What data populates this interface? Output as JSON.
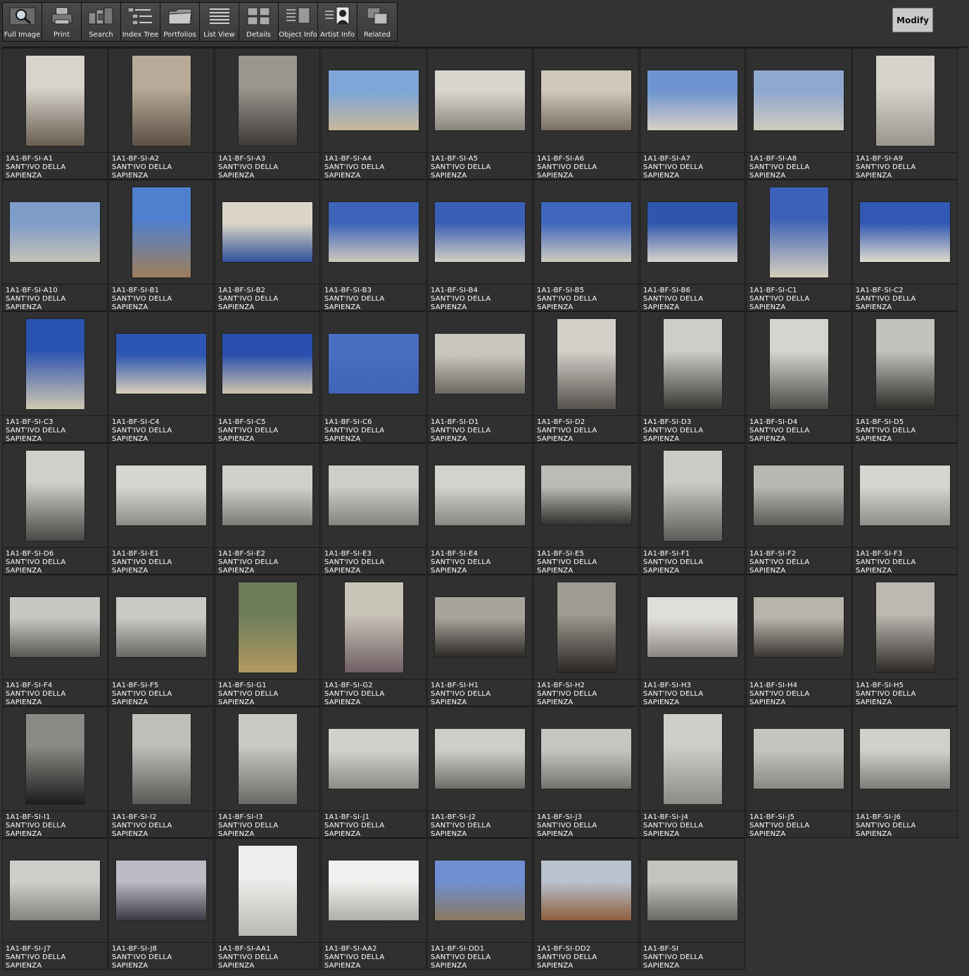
{
  "toolbar": {
    "buttons": [
      {
        "label": "Full Image",
        "icon": "magnifier-icon"
      },
      {
        "label": "Print",
        "icon": "printer-icon"
      },
      {
        "label": "Search",
        "icon": "search-stack-icon"
      },
      {
        "label": "Index Tree",
        "icon": "index-tree-icon"
      },
      {
        "label": "Portfolios",
        "icon": "folder-icon"
      },
      {
        "label": "List View",
        "icon": "list-icon"
      },
      {
        "label": "Details",
        "icon": "details-icon"
      },
      {
        "label": "Object Info",
        "icon": "object-info-icon"
      },
      {
        "label": "Artist  Info",
        "icon": "artist-portrait-icon"
      },
      {
        "label": "Related",
        "icon": "related-squares-icon"
      }
    ]
  },
  "modify_label": "Modify",
  "caption_line2": "SANT'IVO DELLA",
  "caption_line3": "SAPIENZA",
  "items": [
    {
      "id": "1A1-BF-SI-A1",
      "o": "t",
      "c": [
        "#d8d4cc",
        "#6a5e52"
      ]
    },
    {
      "id": "1A1-BF-SI-A2",
      "o": "t",
      "c": [
        "#b7aa98",
        "#5d5147"
      ]
    },
    {
      "id": "1A1-BF-SI-A3",
      "o": "t",
      "c": [
        "#9a958e",
        "#3e3b37"
      ]
    },
    {
      "id": "1A1-BF-SI-A4",
      "o": "w",
      "c": [
        "#7fa6d8",
        "#c9b89c"
      ]
    },
    {
      "id": "1A1-BF-SI-A5",
      "o": "w",
      "c": [
        "#d9d6cf",
        "#8a857c"
      ]
    },
    {
      "id": "1A1-BF-SI-A6",
      "o": "w",
      "c": [
        "#cfc7b8",
        "#7a7064"
      ]
    },
    {
      "id": "1A1-BF-SI-A7",
      "o": "w",
      "c": [
        "#6f94cf",
        "#d6d1c7"
      ]
    },
    {
      "id": "1A1-BF-SI-A8",
      "o": "w",
      "c": [
        "#8fa8cf",
        "#d0cbc0"
      ]
    },
    {
      "id": "1A1-BF-SI-A9",
      "o": "t",
      "c": [
        "#d6d3cc",
        "#9a968e"
      ]
    },
    {
      "id": "1A1-BF-SI-A10",
      "o": "w",
      "c": [
        "#7e9cc8",
        "#c6c1b6"
      ]
    },
    {
      "id": "1A1-BF-SI-B1",
      "o": "t",
      "c": [
        "#4f7fcf",
        "#9e7f5a"
      ]
    },
    {
      "id": "1A1-BF-SI-B2",
      "o": "w",
      "c": [
        "#dcd6c8",
        "#2e4f9a"
      ]
    },
    {
      "id": "1A1-BF-SI-B3",
      "o": "w",
      "c": [
        "#3c63b8",
        "#cfc9bd"
      ]
    },
    {
      "id": "1A1-BF-SI-B4",
      "o": "w",
      "c": [
        "#3a5fb5",
        "#d3cfc4"
      ]
    },
    {
      "id": "1A1-BF-SI-B5",
      "o": "w",
      "c": [
        "#3f66bd",
        "#d0cbbf"
      ]
    },
    {
      "id": "1A1-BF-SI-B6",
      "o": "w",
      "c": [
        "#2f56ad",
        "#d9d5cc"
      ]
    },
    {
      "id": "1A1-BF-SI-C1",
      "o": "t",
      "c": [
        "#3d61b8",
        "#d7cfbd"
      ]
    },
    {
      "id": "1A1-BF-SI-C2",
      "o": "w",
      "c": [
        "#3158b2",
        "#e0dbcf"
      ]
    },
    {
      "id": "1A1-BF-SI-C3",
      "o": "t",
      "c": [
        "#2a52b0",
        "#d1c8b2"
      ]
    },
    {
      "id": "1A1-BF-SI-C4",
      "o": "w",
      "c": [
        "#2d55b3",
        "#d8cfb9"
      ]
    },
    {
      "id": "1A1-BF-SI-C5",
      "o": "w",
      "c": [
        "#2a4fae",
        "#cfc5ad"
      ]
    },
    {
      "id": "1A1-BF-SI-C6",
      "o": "w",
      "c": [
        "#4a6fc2",
        "#3f63b7"
      ]
    },
    {
      "id": "1A1-BF-SI-D1",
      "o": "w",
      "c": [
        "#c9c6bf",
        "#6b6860"
      ]
    },
    {
      "id": "1A1-BF-SI-D2",
      "o": "t",
      "c": [
        "#d3d0ca",
        "#55524c"
      ]
    },
    {
      "id": "1A1-BF-SI-D3",
      "o": "t",
      "c": [
        "#cfcdc7",
        "#3a3835"
      ]
    },
    {
      "id": "1A1-BF-SI-D4",
      "o": "t",
      "c": [
        "#d6d4cf",
        "#4e4c48"
      ]
    },
    {
      "id": "1A1-BF-SI-D5",
      "o": "t",
      "c": [
        "#c4c2bd",
        "#2e2d2a"
      ]
    },
    {
      "id": "1A1-BF-SI-D6",
      "o": "t",
      "c": [
        "#d1cfca",
        "#4a4845"
      ]
    },
    {
      "id": "1A1-BF-SI-E1",
      "o": "w",
      "c": [
        "#d8d6d1",
        "#8d8b86"
      ]
    },
    {
      "id": "1A1-BF-SI-E2",
      "o": "w",
      "c": [
        "#d2d0cb",
        "#7e7c77"
      ]
    },
    {
      "id": "1A1-BF-SI-E3",
      "o": "w",
      "c": [
        "#cfcdc8",
        "#85837e"
      ]
    },
    {
      "id": "1A1-BF-SI-E4",
      "o": "w",
      "c": [
        "#d4d2cd",
        "#8a8883"
      ]
    },
    {
      "id": "1A1-BF-SI-E5",
      "o": "w",
      "c": [
        "#bdbbb6",
        "#2f2e2c"
      ]
    },
    {
      "id": "1A1-BF-SI-F1",
      "o": "t",
      "c": [
        "#cdcbc6",
        "#5e5c58"
      ]
    },
    {
      "id": "1A1-BF-SI-F2",
      "o": "w",
      "c": [
        "#bab8b3",
        "#5d5b57"
      ]
    },
    {
      "id": "1A1-BF-SI-F3",
      "o": "w",
      "c": [
        "#d7d5d0",
        "#8f8d88"
      ]
    },
    {
      "id": "1A1-BF-SI-F4",
      "o": "w",
      "c": [
        "#c8c6c1",
        "#5a5854"
      ]
    },
    {
      "id": "1A1-BF-SI-F5",
      "o": "w",
      "c": [
        "#cbc9c4",
        "#6a6864"
      ]
    },
    {
      "id": "1A1-BF-SI-G1",
      "o": "t",
      "c": [
        "#6c7d5a",
        "#b39a5f"
      ]
    },
    {
      "id": "1A1-BF-SI-G2",
      "o": "t",
      "c": [
        "#c9c4b8",
        "#6f5f63"
      ]
    },
    {
      "id": "1A1-BF-SI-H1",
      "o": "w",
      "c": [
        "#a8a39b",
        "#2c2926"
      ]
    },
    {
      "id": "1A1-BF-SI-H2",
      "o": "t",
      "c": [
        "#9f9a92",
        "#2a2724"
      ]
    },
    {
      "id": "1A1-BF-SI-H3",
      "o": "w",
      "c": [
        "#e0ded9",
        "#8a8782"
      ]
    },
    {
      "id": "1A1-BF-SI-H4",
      "o": "w",
      "c": [
        "#b8b3ab",
        "#3a3632"
      ]
    },
    {
      "id": "1A1-BF-SI-H5",
      "o": "t",
      "c": [
        "#bdb9b2",
        "#2d2a27"
      ]
    },
    {
      "id": "1A1-BF-SI-I1",
      "o": "t",
      "c": [
        "#8c8a86",
        "#1e1d1c"
      ]
    },
    {
      "id": "1A1-BF-SI-I2",
      "o": "t",
      "c": [
        "#c0beb9",
        "#5b5955"
      ]
    },
    {
      "id": "1A1-BF-SI-I3",
      "o": "t",
      "c": [
        "#cbc9c4",
        "#6c6a66"
      ]
    },
    {
      "id": "1A1-BF-SI-J1",
      "o": "w",
      "c": [
        "#d2d0cb",
        "#8e8c87"
      ]
    },
    {
      "id": "1A1-BF-SI-J2",
      "o": "w",
      "c": [
        "#cfcdc7",
        "#6f6d68"
      ]
    },
    {
      "id": "1A1-BF-SI-J3",
      "o": "w",
      "c": [
        "#c7c5c0",
        "#75736e"
      ]
    },
    {
      "id": "1A1-BF-SI-J4",
      "o": "t",
      "c": [
        "#d0cec9",
        "#8d8b86"
      ]
    },
    {
      "id": "1A1-BF-SI-J5",
      "o": "w",
      "c": [
        "#c6c4bf",
        "#8a8883"
      ]
    },
    {
      "id": "1A1-BF-SI-J6",
      "o": "w",
      "c": [
        "#d2d0cb",
        "#7f7d78"
      ]
    },
    {
      "id": "1A1-BF-SI-J7",
      "o": "w",
      "c": [
        "#d0ceca",
        "#85837f"
      ]
    },
    {
      "id": "1A1-BF-SI-J8",
      "o": "w",
      "c": [
        "#bcbcc4",
        "#3b3a44"
      ]
    },
    {
      "id": "1A1-BF-SI-AA1",
      "o": "t",
      "c": [
        "#eeeeec",
        "#b8b8b4"
      ]
    },
    {
      "id": "1A1-BF-SI-AA2",
      "o": "w",
      "c": [
        "#f0f0ee",
        "#aeaeaa"
      ]
    },
    {
      "id": "1A1-BF-SI-DD1",
      "o": "w",
      "c": [
        "#6f8fd2",
        "#8a7a5f"
      ]
    },
    {
      "id": "1A1-BF-SI-DD2",
      "o": "w",
      "c": [
        "#b9c2cf",
        "#8c5e3b"
      ]
    },
    {
      "id": "1A1-BF-SI",
      "o": "w",
      "c": [
        "#c5c3be",
        "#6a6864"
      ]
    }
  ]
}
